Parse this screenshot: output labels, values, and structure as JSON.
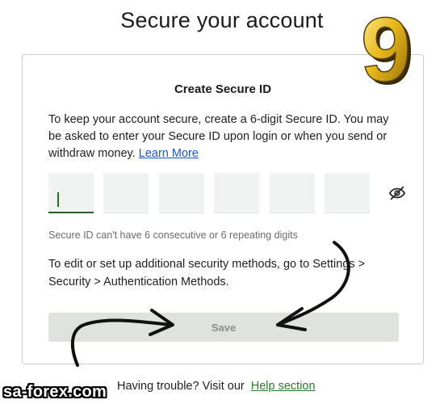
{
  "page": {
    "title": "Secure your account"
  },
  "card": {
    "title": "Create Secure ID",
    "intro": "To keep your account secure, create a 6-digit Secure ID. You may be asked to enter your Secure ID upon login or when you send or withdraw money.",
    "learn_more": "Learn More",
    "digits": [
      "",
      "",
      "",
      "",
      "",
      ""
    ],
    "hint": "Secure ID can't have 6 consecutive or 6 repeating digits",
    "more_info": "To edit or set up additional security methods, go to Settings > Security > Authentication Methods.",
    "save_label": "Save"
  },
  "footer": {
    "text": "Having trouble? Visit our",
    "help_link": "Help section"
  },
  "icons": {
    "visibility": "eye-off-icon"
  },
  "overlay": {
    "badge_text": "9",
    "watermark": "sa-forex.com"
  },
  "colors": {
    "accent_green": "#2d5d2f",
    "link_blue": "#1a56d6",
    "help_green": "#2d7a2f",
    "button_disabled": "#dfe2df",
    "badge_gold": "#e8b81c"
  }
}
